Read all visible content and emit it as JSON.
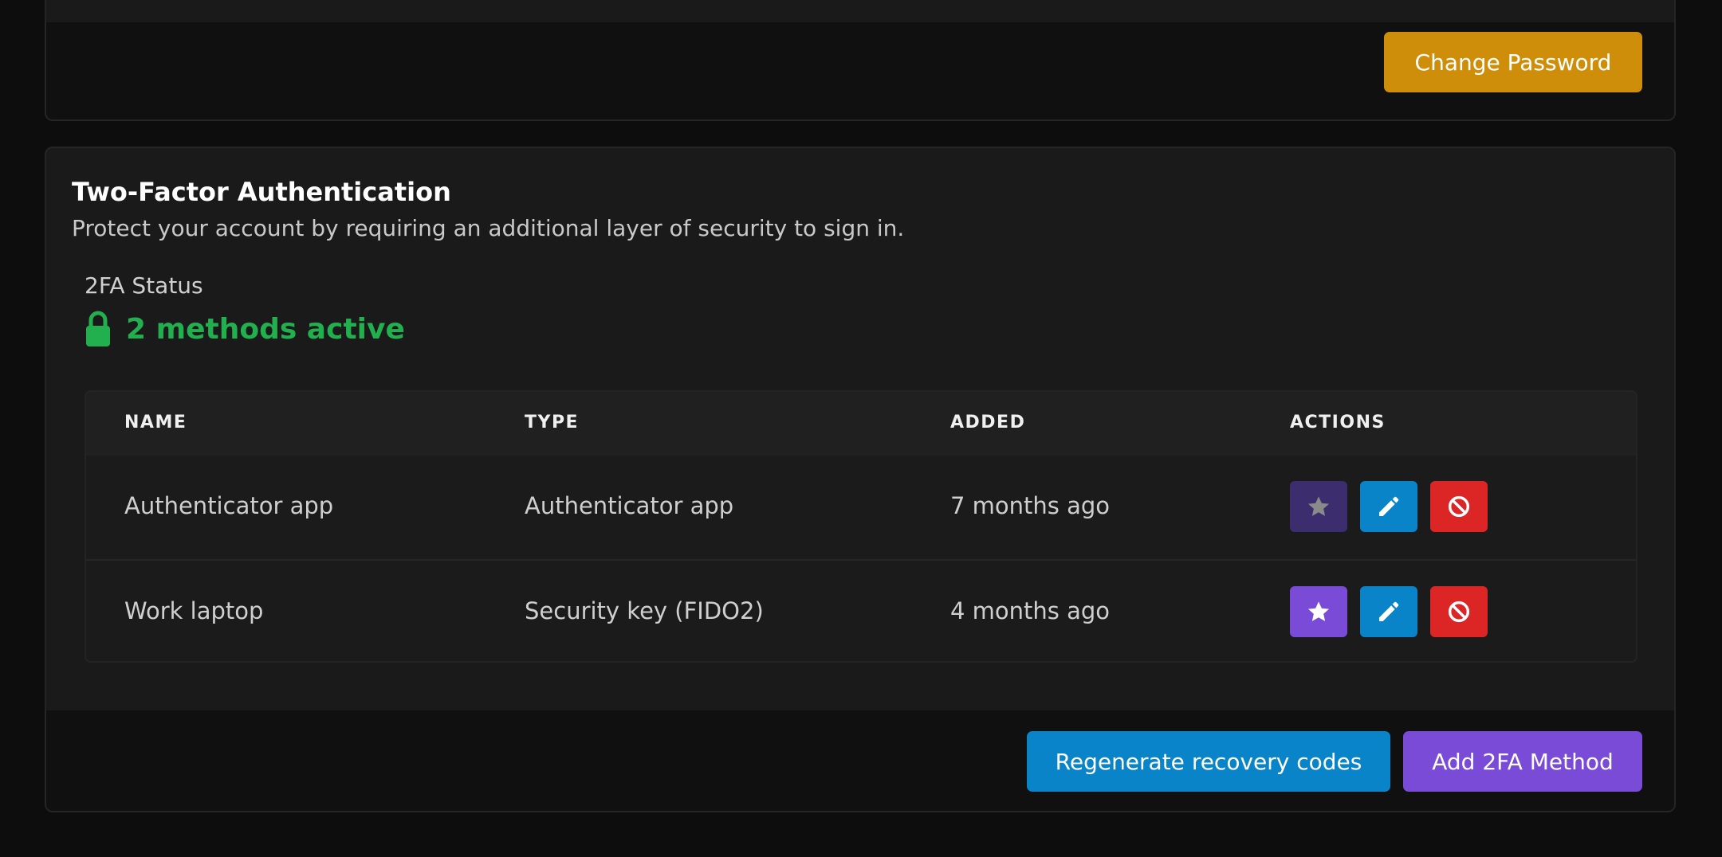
{
  "password_section": {
    "change_password_label": "Change Password",
    "change_password_color": "#cf8e0a"
  },
  "two_factor": {
    "title": "Two-Factor Authentication",
    "description": "Protect your account by requiring an additional layer of security to sign in.",
    "status_label": "2FA Status",
    "status_value": "2 methods active",
    "status_icon": "lock-icon",
    "status_color": "#22b04f",
    "table": {
      "columns": [
        "NAME",
        "TYPE",
        "ADDED",
        "ACTIONS"
      ],
      "rows": [
        {
          "name": "Authenticator app",
          "type": "Authenticator app",
          "added": "7 months ago",
          "is_default": true
        },
        {
          "name": "Work laptop",
          "type": "Security key (FIDO2)",
          "added": "4 months ago",
          "is_default": false
        }
      ],
      "action_icons": [
        "star-icon",
        "pencil-icon",
        "ban-icon"
      ]
    },
    "regenerate_label": "Regenerate recovery codes",
    "add_method_label": "Add 2FA Method",
    "colors": {
      "primary_blue": "#0a84c9",
      "purple": "#7a4bd6",
      "danger": "#dc2626"
    }
  }
}
